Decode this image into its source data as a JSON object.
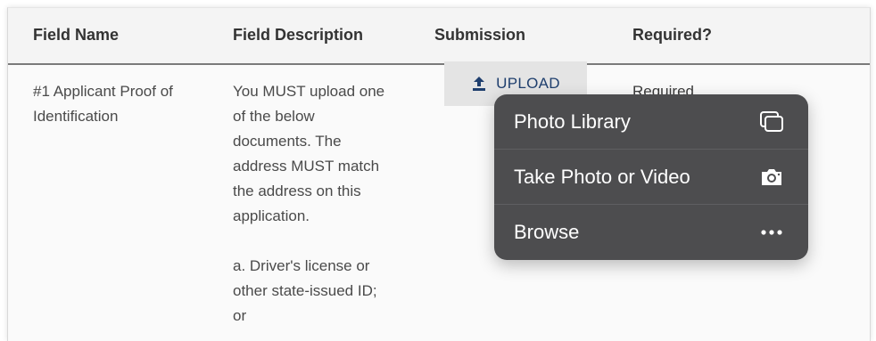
{
  "table": {
    "headers": {
      "field_name": "Field Name",
      "field_description": "Field Description",
      "submission": "Submission",
      "required": "Required?"
    },
    "row": {
      "field_name": "#1 Applicant Proof of\nIdentification",
      "field_description": "You MUST upload one\nof the below\ndocuments. The\naddress MUST match\nthe address on this\napplication.\n\na. Driver's license or\nother state-issued ID;\nor",
      "required": "Required"
    }
  },
  "upload": {
    "label": "UPLOAD",
    "icon": "upload-icon",
    "color": "#1f3f6e"
  },
  "menu": {
    "items": [
      {
        "label": "Photo Library",
        "icon": "photo-library-icon"
      },
      {
        "label": "Take Photo or Video",
        "icon": "camera-icon"
      },
      {
        "label": "Browse",
        "icon": "more-icon"
      }
    ],
    "background": "#4d4d4f"
  }
}
